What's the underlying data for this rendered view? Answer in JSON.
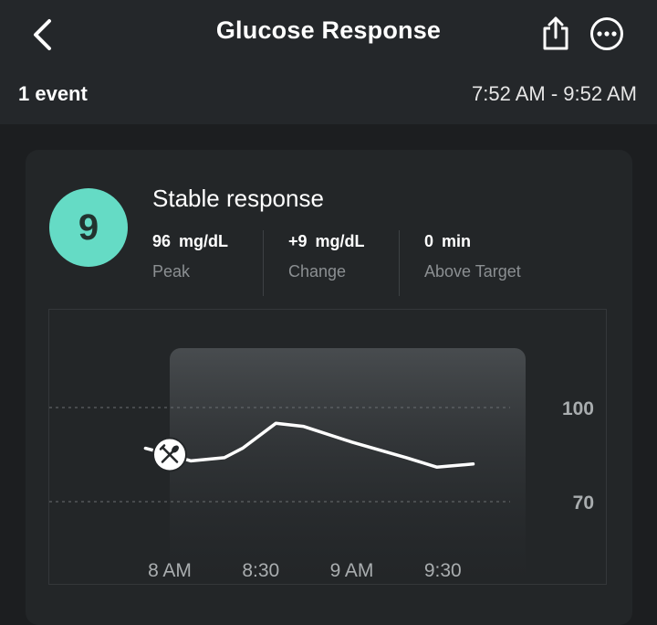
{
  "header": {
    "title": "Glucose Response",
    "back_icon": "chevron-left-icon",
    "share_icon": "share-icon",
    "more_icon": "more-options-icon"
  },
  "summary": {
    "event_count": "1 event",
    "time_range": "7:52 AM - 9:52 AM"
  },
  "card": {
    "score": "9",
    "score_color": "#65dbc5",
    "response_label": "Stable response",
    "metrics": [
      {
        "value": "96 mg/dL",
        "label": "Peak"
      },
      {
        "value": "+9 mg/dL",
        "label": "Change"
      },
      {
        "value": "0 min",
        "label": "Above Target"
      }
    ]
  },
  "chart_data": {
    "type": "line",
    "x": [
      "7:52 AM",
      "8:00 AM",
      "8:07 AM",
      "8:18 AM",
      "8:24 AM",
      "8:35 AM",
      "8:44 AM",
      "9:00 AM",
      "9:18 AM",
      "9:28 AM",
      "9:40 AM"
    ],
    "x_ticks": [
      "8 AM",
      "8:30",
      "9 AM",
      "9:30"
    ],
    "y_ticks": [
      "100",
      "70"
    ],
    "ylim": [
      60,
      120
    ],
    "target_range": [
      70,
      100
    ],
    "meal_marker": {
      "time": "8:00 AM",
      "icon": "fork-knife-icon"
    },
    "series": [
      {
        "values": [
          87,
          85,
          83,
          84,
          87,
          95,
          94,
          89,
          84,
          81,
          82
        ]
      }
    ],
    "response_window": [
      "8:00 AM",
      "9:52 AM"
    ]
  }
}
